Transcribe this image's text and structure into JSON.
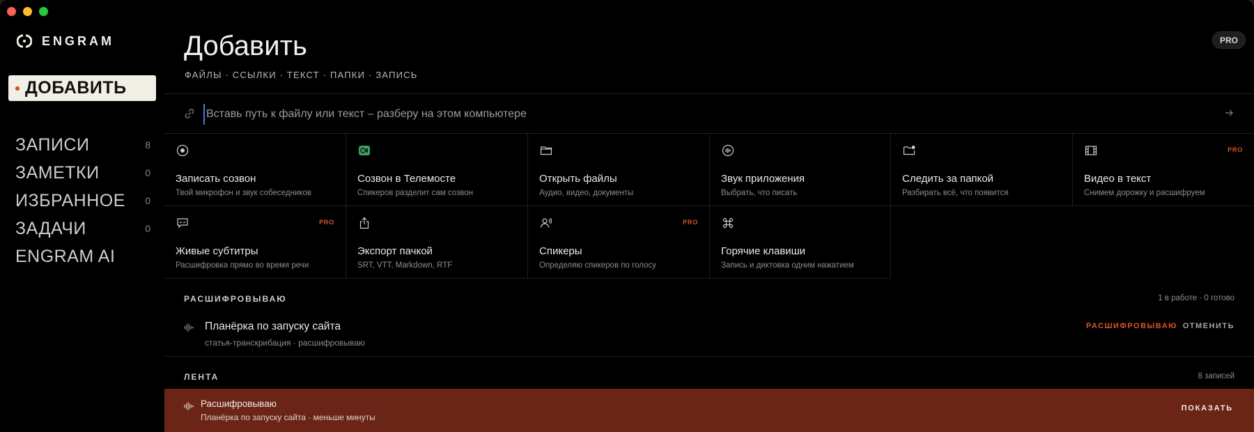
{
  "brand": {
    "name": "ENGRAM"
  },
  "sidebar": {
    "active": "ДОБАВИТЬ",
    "items": [
      {
        "label": "ЗАПИСИ",
        "count": "8"
      },
      {
        "label": "ЗАМЕТКИ",
        "count": "0"
      },
      {
        "label": "ИЗБРАННОЕ",
        "count": "0"
      },
      {
        "label": "ЗАДАЧИ",
        "count": "0"
      },
      {
        "label": "ENGRAM AI",
        "count": ""
      }
    ]
  },
  "header": {
    "title": "Добавить",
    "subtitle": "ФАЙЛЫ · ССЫЛКИ · ТЕКСТ · ПАПКИ · ЗАПИСЬ",
    "badge": "PRO"
  },
  "input": {
    "placeholder": "Вставь путь к файлу или текст – разберу на этом компьютере",
    "value": ""
  },
  "actions": [
    {
      "icon": "record-icon",
      "title": "Записать созвон",
      "desc": "Твой микрофон и звук собеседников",
      "pro": ""
    },
    {
      "icon": "telemost-icon",
      "title": "Созвон в Телемосте",
      "desc": "Спикеров разделит сам созвон",
      "pro": ""
    },
    {
      "icon": "folder-icon",
      "title": "Открыть файлы",
      "desc": "Аудио, видео, документы",
      "pro": ""
    },
    {
      "icon": "app-audio-icon",
      "title": "Звук приложения",
      "desc": "Выбрать, что писать",
      "pro": ""
    },
    {
      "icon": "watch-folder-icon",
      "title": "Следить за папкой",
      "desc": "Разбирать всё, что появится",
      "pro": ""
    },
    {
      "icon": "film-icon",
      "title": "Видео в текст",
      "desc": "Снимем дорожку и расшифруем",
      "pro": "PRO"
    },
    {
      "icon": "subtitles-icon",
      "title": "Живые субтитры",
      "desc": "Расшифровка прямо во время речи",
      "pro": "PRO"
    },
    {
      "icon": "export-icon",
      "title": "Экспорт пачкой",
      "desc": "SRT, VTT, Markdown, RTF",
      "pro": ""
    },
    {
      "icon": "speakers-icon",
      "title": "Спикеры",
      "desc": "Определяю спикеров по голосу",
      "pro": "PRO"
    },
    {
      "icon": "command-icon",
      "title": "Горячие клавиши",
      "desc": "Запись и диктовка одним нажатием",
      "pro": ""
    }
  ],
  "transcribing": {
    "label": "РАСШИФРОВЫВАЮ",
    "meta": "1 в работе · 0 готово",
    "job": {
      "title": "Планёрка по запуску сайта",
      "sub": "статья-транскрибация · расшифровываю",
      "status": "РАСШИФРОВЫВАЮ",
      "cancel": "ОТМЕНИТЬ"
    }
  },
  "feed": {
    "label": "ЛЕНТА",
    "meta": "8 записей"
  },
  "toast": {
    "title": "Расшифровываю",
    "sub": "Планёрка по запуску сайта · меньше минуты",
    "action": "ПОКАЗАТЬ"
  },
  "colors": {
    "accent": "#d9542b",
    "toast_bg": "#6a2516",
    "active_nav_bg": "#f2efe6",
    "caret": "#4a74f0"
  }
}
